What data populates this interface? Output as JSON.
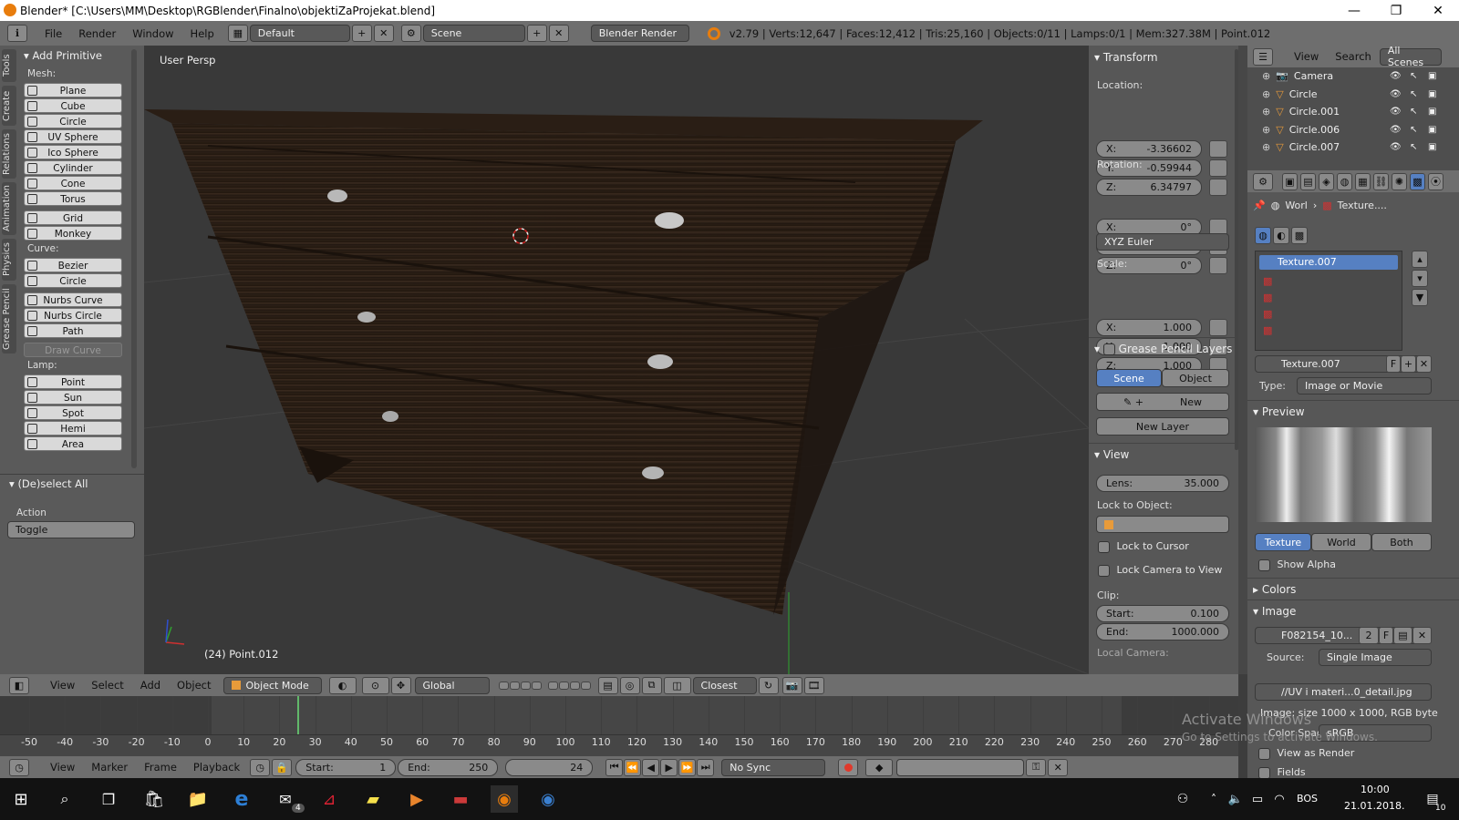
{
  "window": {
    "title": "Blender* [C:\\Users\\MM\\Desktop\\RGBlender\\Finalno\\objektiZaProjekat.blend]",
    "minimize": "—",
    "maximize": "❐",
    "close": "✕"
  },
  "topbar": {
    "menus": [
      "File",
      "Render",
      "Window",
      "Help"
    ],
    "screen_layout": "Default",
    "scene": "Scene",
    "engine": "Blender Render",
    "stats": "v2.79 | Verts:12,647 | Faces:12,412 | Tris:25,160 | Objects:0/11 | Lamps:0/1 | Mem:327.38M | Point.012"
  },
  "tool_tabs": [
    "Tools",
    "Create",
    "Relations",
    "Animation",
    "Physics",
    "Grease Pencil"
  ],
  "tools": {
    "panel_title": "Add Primitive",
    "mesh_label": "Mesh:",
    "mesh": [
      "Plane",
      "Cube",
      "Circle",
      "UV Sphere",
      "Ico Sphere",
      "Cylinder",
      "Cone",
      "Torus"
    ],
    "mesh2": [
      "Grid",
      "Monkey"
    ],
    "curve_label": "Curve:",
    "curve": [
      "Bezier",
      "Circle"
    ],
    "curve2": [
      "Nurbs Curve",
      "Nurbs Circle",
      "Path"
    ],
    "draw_curve": "Draw Curve",
    "lamp_label": "Lamp:",
    "lamp": [
      "Point",
      "Sun",
      "Spot",
      "Hemi",
      "Area"
    ],
    "operator_title": "(De)select All",
    "action_label": "Action",
    "action_value": "Toggle"
  },
  "viewport": {
    "view_name": "User Persp",
    "object_info": "(24) Point.012"
  },
  "transform": {
    "title": "Transform",
    "location_label": "Location:",
    "location": [
      {
        "axis": "X:",
        "value": "-3.36602"
      },
      {
        "axis": "Y:",
        "value": "-0.59944"
      },
      {
        "axis": "Z:",
        "value": "6.34797"
      }
    ],
    "rotation_label": "Rotation:",
    "rotation": [
      {
        "axis": "X:",
        "value": "0°"
      },
      {
        "axis": "Y:",
        "value": "0°"
      },
      {
        "axis": "Z:",
        "value": "0°"
      }
    ],
    "rotation_mode": "XYZ Euler",
    "scale_label": "Scale:",
    "scale": [
      {
        "axis": "X:",
        "value": "1.000"
      },
      {
        "axis": "Y:",
        "value": "1.000"
      },
      {
        "axis": "Z:",
        "value": "1.000"
      }
    ]
  },
  "grease_pencil": {
    "title": "Grease Pencil Layers",
    "tab_scene": "Scene",
    "tab_object": "Object",
    "new_label": "New",
    "new_layer": "New Layer"
  },
  "view_panel": {
    "title": "View",
    "lens_label": "Lens:",
    "lens_value": "35.000",
    "lock_object_label": "Lock to Object:",
    "lock_cursor": "Lock to Cursor",
    "lock_camera": "Lock Camera to View",
    "clip_label": "Clip:",
    "clip_start_label": "Start:",
    "clip_start": "0.100",
    "clip_end_label": "End:",
    "clip_end": "1000.000",
    "local_camera": "Local Camera:"
  },
  "outliner": {
    "view": "View",
    "search": "Search",
    "scope": "All Scenes",
    "items": [
      "Camera",
      "Circle",
      "Circle.001",
      "Circle.006",
      "Circle.007"
    ]
  },
  "properties": {
    "breadcrumb_world": "Worl",
    "breadcrumb_texture": "Texture....",
    "texture_slot_selected": "Texture.007",
    "texture_name": "Texture.007",
    "fake_user": "F",
    "type_label": "Type:",
    "type_value": "Image or Movie",
    "preview_title": "Preview",
    "preview_tabs": [
      "Texture",
      "World",
      "Both"
    ],
    "show_alpha": "Show Alpha",
    "colors_title": "Colors",
    "image_title": "Image",
    "image_name": "F082154_10...",
    "image_users": "2",
    "source_label": "Source:",
    "source_value": "Single Image",
    "filepath": "//UV i materi...0_detail.jpg",
    "image_info": "Image: size 1000 x 1000, RGB byte",
    "color_space_label": "Color Space:",
    "color_space": "sRGB",
    "view_as_render": "View as Render",
    "fields": "Fields"
  },
  "viewport_header": {
    "menus": [
      "View",
      "Select",
      "Add",
      "Object"
    ],
    "mode": "Object Mode",
    "orientation": "Global",
    "snap": "Closest"
  },
  "timeline": {
    "ticks": [
      "-50",
      "-40",
      "-30",
      "-20",
      "-10",
      "0",
      "10",
      "20",
      "30",
      "40",
      "50",
      "60",
      "70",
      "80",
      "90",
      "100",
      "110",
      "120",
      "130",
      "140",
      "150",
      "160",
      "170",
      "180",
      "190",
      "200",
      "210",
      "220",
      "230",
      "240",
      "250",
      "260",
      "270",
      "280"
    ],
    "current_frame_marker": 24,
    "menus": [
      "View",
      "Marker",
      "Frame",
      "Playback"
    ],
    "start_label": "Start:",
    "start": "1",
    "end_label": "End:",
    "end": "250",
    "current": "24",
    "sync": "No Sync"
  },
  "watermark": {
    "line1": "Activate Windows",
    "line2": "Go to Settings to activate Windows."
  },
  "taskbar": {
    "mail_badge": "4",
    "lang": "BOS",
    "time": "10:00",
    "date": "21.01.2018.",
    "notif_count": "10"
  }
}
